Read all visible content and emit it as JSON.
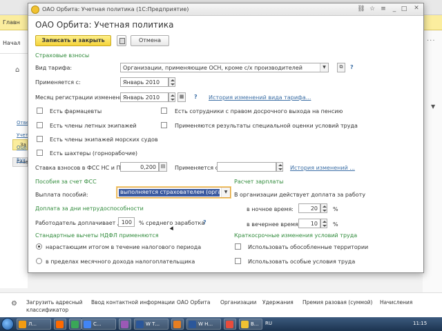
{
  "background": {
    "top_section": [
      "Главн",
      "Начал"
    ],
    "left_links": [
      "Отве",
      "Учет",
      "Оце",
      "Бух"
    ],
    "left_button": "За",
    "left_tab": "Глав",
    "bottom_links": [
      "Загрузить адресный классификатор",
      "Ввод контактной информации",
      "ОАО Орбита",
      "Организации",
      "Удержания",
      "Премия разовая (суммой)",
      "Начисления"
    ]
  },
  "taskbar": {
    "tasks": [
      {
        "label": "Л...",
        "color": "#f39c12"
      },
      {
        "label": "",
        "color": "#ff6a00"
      },
      {
        "label": "",
        "color": "#3aa757"
      },
      {
        "label": "С...",
        "color": "#4285f4"
      },
      {
        "label": "",
        "color": "#9b59b6"
      },
      {
        "label": "W Т...",
        "color": "#2b579a"
      },
      {
        "label": "",
        "color": "#e67e22"
      },
      {
        "label": "W Н...",
        "color": "#2b579a"
      },
      {
        "label": "",
        "color": "#e74c3c"
      },
      {
        "label": "В...",
        "color": "#f1c232"
      }
    ],
    "lang": "RU",
    "clock": "11:15"
  },
  "window": {
    "title": "ОАО Орбита: Учетная политика (1С:Предприятие)",
    "form_title": "ОАО Орбита: Учетная политика",
    "buttons": {
      "save_close": "Записать и закрыть",
      "cancel": "Отмена"
    },
    "insurance": {
      "section": "Страховые взносы",
      "tariff_label": "Вид тарифа:",
      "tariff_value": "Организации, применяющие ОСН, кроме с/х производителей",
      "applied_from_label": "Применяется с:",
      "applied_from_value": "Январь 2010",
      "reg_month_label": "Месяц регистрации изменений:",
      "reg_month_value": "Январь 2010",
      "history_link": "История изменений вида тарифа...",
      "checkboxes": [
        {
          "label": "Есть фармацевты",
          "checked": false
        },
        {
          "label": "Есть члены летных экипажей",
          "checked": false
        },
        {
          "label": "Есть члены экипажей морских судов",
          "checked": false
        },
        {
          "label": "Есть шахтеры (горнорабочие)",
          "checked": false
        },
        {
          "label": "Есть сотрудники с правом досрочного выхода на пенсию",
          "checked": false
        },
        {
          "label": "Применяются результаты специальной оценки условий труда",
          "checked": false
        }
      ],
      "fss_rate_label": "Ставка взносов в ФСС НС и ПЗ:",
      "fss_rate_value": "0,200",
      "fss_applied_label": "Применяется с:",
      "fss_history_link": "История изменений ..."
    },
    "fss_benefits": {
      "section": "Пособия за счет ФСС",
      "payment_label": "Выплата пособий:",
      "payment_value": "выполняется страхователем (организа"
    },
    "disability": {
      "section": "Доплата за дни нетрудоспособности",
      "employer_label": "Работодатель доплачивает до:",
      "employer_value": "100",
      "employer_suffix": "% среднего заработка"
    },
    "salary": {
      "section": "Расчет зарплаты",
      "extra_label": "В организации действует доплата за работу",
      "night_label": "в ночное время:",
      "night_value": "20",
      "evening_label": "в вечернее время:",
      "evening_value": "10",
      "percent": "%"
    },
    "ndfl": {
      "section": "Стандартные вычеты НДФЛ применяются",
      "options": [
        {
          "label": "нарастающим итогом в течение налогового периода",
          "selected": true
        },
        {
          "label": "в пределах месячного дохода налогоплательщика",
          "selected": false
        }
      ]
    },
    "labor": {
      "section": "Краткосрочные изменения условий труда",
      "options": [
        {
          "label": "Использовать обособленные территории",
          "checked": false
        },
        {
          "label": "Использовать особые условия труда",
          "checked": false
        }
      ]
    },
    "help_mark": "?"
  }
}
